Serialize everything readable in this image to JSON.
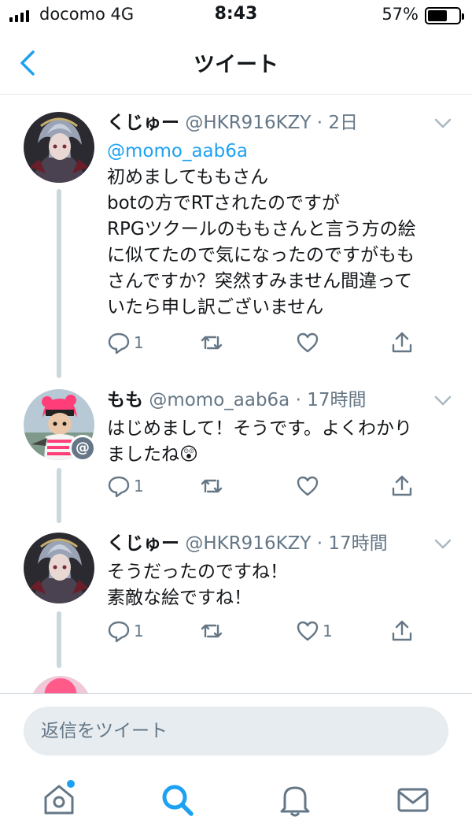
{
  "status_bar": {
    "carrier": "docomo  4G",
    "time": "8:43",
    "battery_percent": "57%",
    "battery_level": 0.57
  },
  "nav": {
    "title": "ツイート"
  },
  "tweets": [
    {
      "name": "くじゅー",
      "handle": "@HKR916KZY · 2日",
      "mention": "@momo_aab6a",
      "lines": [
        "初めましてももさん",
        "botの方でRTされたのですが",
        "RPGツクールのももさんと言う方の絵",
        "に似てたので気になったのですがもも",
        "さんですか？突然すみません間違って",
        "いたら申し訳ございません"
      ],
      "reply_count": "1",
      "like_count": ""
    },
    {
      "name": "もも",
      "handle": "@momo_aab6a · 17時間",
      "lines": [
        "はじめまして！そうです。よくわかり",
        "ましたね😲"
      ],
      "reply_count": "1",
      "like_count": ""
    },
    {
      "name": "くじゅー",
      "handle": "@HKR916KZY · 17時間",
      "lines": [
        "そうだったのですね！",
        "素敵な絵ですね！"
      ],
      "reply_count": "1",
      "like_count": "1"
    }
  ],
  "mention_badge": "@",
  "reply_bar": {
    "placeholder": "返信をツイート"
  },
  "tab_bar": {
    "items": [
      "home-icon",
      "search-icon",
      "notifications-icon",
      "messages-icon"
    ],
    "active": "search-icon",
    "accent": "#1da1f2"
  },
  "colors": {
    "accent": "#1da1f2",
    "secondary_text": "#657786",
    "thread_line": "#ccd6dd"
  }
}
